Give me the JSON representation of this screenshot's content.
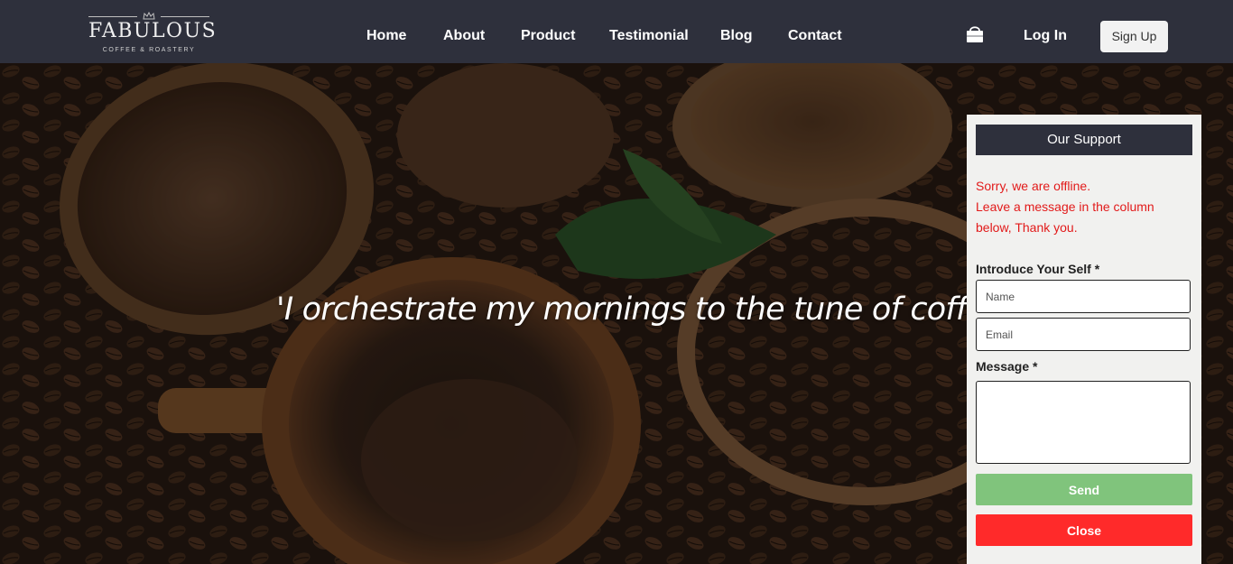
{
  "brand": {
    "name": "FABULOUS",
    "tagline": "COFFEE & ROASTERY"
  },
  "nav": {
    "items": [
      {
        "label": "Home"
      },
      {
        "label": "About"
      },
      {
        "label": "Product"
      },
      {
        "label": "Testimonial"
      },
      {
        "label": "Blog"
      },
      {
        "label": "Contact"
      }
    ],
    "cart_icon": "shopping-bag-icon",
    "login_label": "Log In",
    "signup_label": "Sign Up"
  },
  "hero": {
    "quote": "'I orchestrate my mornings to the tune of coffee'"
  },
  "support": {
    "title": "Our Support",
    "offline_lines": [
      "Sorry, we are offline.",
      "Leave a message in the column below, Thank you."
    ],
    "intro_label": "Introduce Your Self *",
    "name_placeholder": "Name",
    "email_placeholder": "Email",
    "message_label": "Message *",
    "send_label": "Send",
    "close_label": "Close"
  },
  "colors": {
    "nav_bg": "#2e303c",
    "send": "#80c47c",
    "close": "#ff2a2a",
    "offline_text": "#e21a1a"
  }
}
